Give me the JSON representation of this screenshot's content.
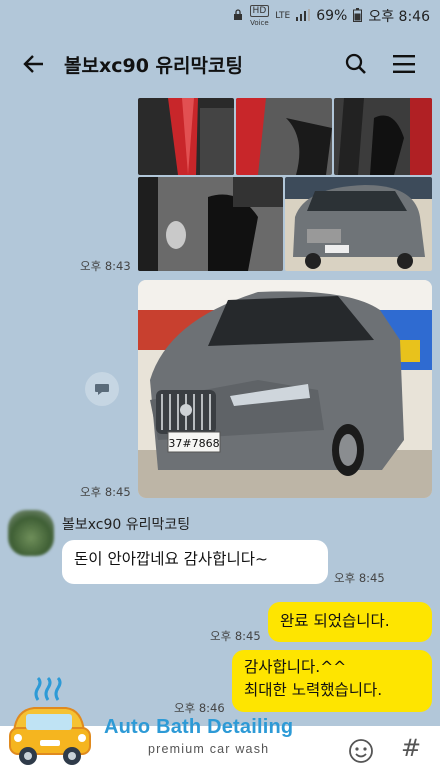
{
  "status_bar": {
    "hd": "HD",
    "voice": "Voice",
    "lte": "LTE",
    "battery": "69%",
    "clock": "오후 8:46"
  },
  "header": {
    "title": "볼보xc90 유리막코팅",
    "icons": [
      "back-arrow-icon",
      "search-icon",
      "menu-icon"
    ]
  },
  "messages": {
    "photos_time_1": "오후 8:43",
    "photos_time_2": "오후 8:45",
    "plate_text": "37#7868",
    "sender_name": "볼보xc90 유리막코팅",
    "incoming_text": "돈이 안아깝네요 감사합니다~",
    "incoming_time": "오후 8:45",
    "out1_text": "완료 되었습니다.",
    "out1_time": "오후 8:45",
    "out2_line1": "감사합니다.^^",
    "out2_line2": "최대한 노력했습니다.",
    "out2_time": "오후 8:46"
  },
  "branding": {
    "name": "Auto Bath Detailing",
    "tagline": "premium car wash"
  },
  "input_bar": {
    "emoji_icon": "emoji-icon",
    "hash_icon": "hash-icon",
    "hash_label": "#"
  },
  "colors": {
    "chat_bg": "#b2c7d9",
    "outgoing_bubble": "#fee500",
    "incoming_bubble": "#ffffff",
    "brand": "#2d9ad6"
  }
}
